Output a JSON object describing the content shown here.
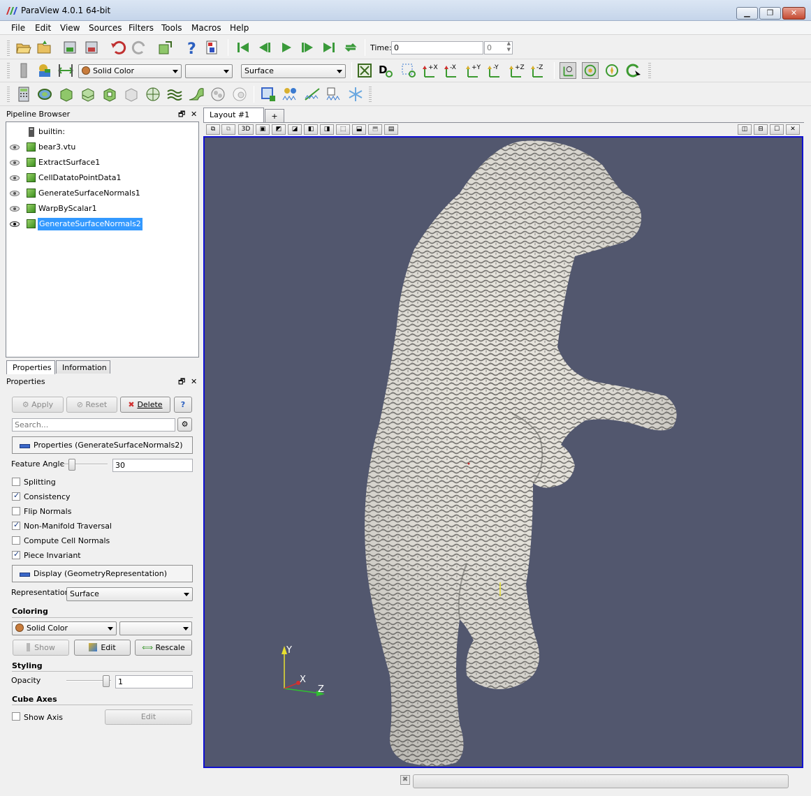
{
  "window": {
    "title": "ParaView 4.0.1 64-bit"
  },
  "menu": [
    "File",
    "Edit",
    "View",
    "Sources",
    "Filters",
    "Tools",
    "Macros",
    "Help"
  ],
  "toolbar": {
    "time_label": "Time:",
    "time_value": "0",
    "time_step": "0",
    "color_by": "Solid Color",
    "component": "",
    "representation": "Surface"
  },
  "pipeline": {
    "title": "Pipeline Browser",
    "items": [
      {
        "label": "builtin:",
        "visible": null
      },
      {
        "label": "bear3.vtu",
        "visible": false
      },
      {
        "label": "ExtractSurface1",
        "visible": false
      },
      {
        "label": "CellDatatoPointData1",
        "visible": false
      },
      {
        "label": "GenerateSurfaceNormals1",
        "visible": false
      },
      {
        "label": "WarpByScalar1",
        "visible": false
      },
      {
        "label": "GenerateSurfaceNormals2",
        "visible": true,
        "selected": true
      }
    ]
  },
  "tabs": {
    "properties": "Properties",
    "information": "Information"
  },
  "properties": {
    "title": "Properties",
    "apply": "Apply",
    "reset": "Reset",
    "delete": "Delete",
    "help": "?",
    "search_placeholder": "Search...",
    "section_filter": "Properties (GenerateSurfaceNormals2)",
    "feature_angle_label": "Feature Angle",
    "feature_angle_value": "30",
    "checkboxes": [
      {
        "label": "Splitting",
        "checked": false
      },
      {
        "label": "Consistency",
        "checked": true
      },
      {
        "label": "Flip Normals",
        "checked": false
      },
      {
        "label": "Non-Manifold Traversal",
        "checked": true
      },
      {
        "label": "Compute Cell Normals",
        "checked": false
      },
      {
        "label": "Piece Invariant",
        "checked": true
      }
    ],
    "section_display": "Display (GeometryRepresentation)",
    "representation_label": "Representation",
    "representation_value": "Surface",
    "coloring_header": "Coloring",
    "coloring_value": "Solid Color",
    "coloring_component": "",
    "show_btn": "Show",
    "edit_btn": "Edit",
    "rescale_btn": "Rescale",
    "styling_header": "Styling",
    "opacity_label": "Opacity",
    "opacity_value": "1",
    "cube_axes_header": "Cube Axes",
    "show_axis_label": "Show Axis",
    "cube_edit_btn": "Edit"
  },
  "layout": {
    "tab_label": "Layout #1",
    "add_tab": "+",
    "view_3d_btn": "3D"
  },
  "orientation_axes": {
    "y": "Y",
    "x": "X",
    "z": "Z"
  },
  "colors": {
    "background": "#52576e",
    "selection": "#3399ff",
    "view_border": "#1010d0",
    "surface": "#e7e4dc"
  }
}
